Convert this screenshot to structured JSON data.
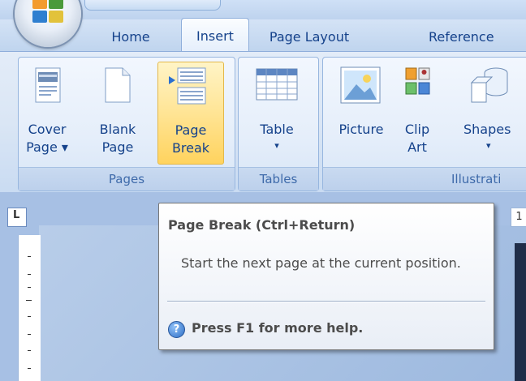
{
  "ribbon": {
    "tabs": [
      "Home",
      "Insert",
      "Page Layout",
      "Reference"
    ],
    "active_tab": "Insert",
    "groups": {
      "pages": {
        "label": "Pages",
        "buttons": [
          {
            "line1": "Cover",
            "line2": "Page ▾",
            "icon": "cover-page-icon"
          },
          {
            "line1": "Blank",
            "line2": "Page",
            "icon": "blank-page-icon"
          },
          {
            "line1": "Page",
            "line2": "Break",
            "icon": "page-break-icon"
          }
        ]
      },
      "tables": {
        "label": "Tables",
        "buttons": [
          {
            "line1": "Table",
            "line2": "▾",
            "icon": "table-icon"
          }
        ]
      },
      "illustrations": {
        "label": "Illustrati",
        "buttons": [
          {
            "line1": "Picture",
            "line2": "",
            "icon": "picture-icon"
          },
          {
            "line1": "Clip",
            "line2": "Art",
            "icon": "clip-art-icon"
          },
          {
            "line1": "Shapes",
            "line2": "▾",
            "icon": "shapes-icon"
          }
        ]
      }
    }
  },
  "ruler": {
    "corner_glyph": "L",
    "h_number": "1"
  },
  "tooltip": {
    "title": "Page Break (Ctrl+Return)",
    "description": "Start the next page at the current position.",
    "help": "Press F1 for more help.",
    "help_glyph": "?"
  },
  "colors": {
    "accent": "#15428b",
    "hover": "#ffd35e"
  }
}
